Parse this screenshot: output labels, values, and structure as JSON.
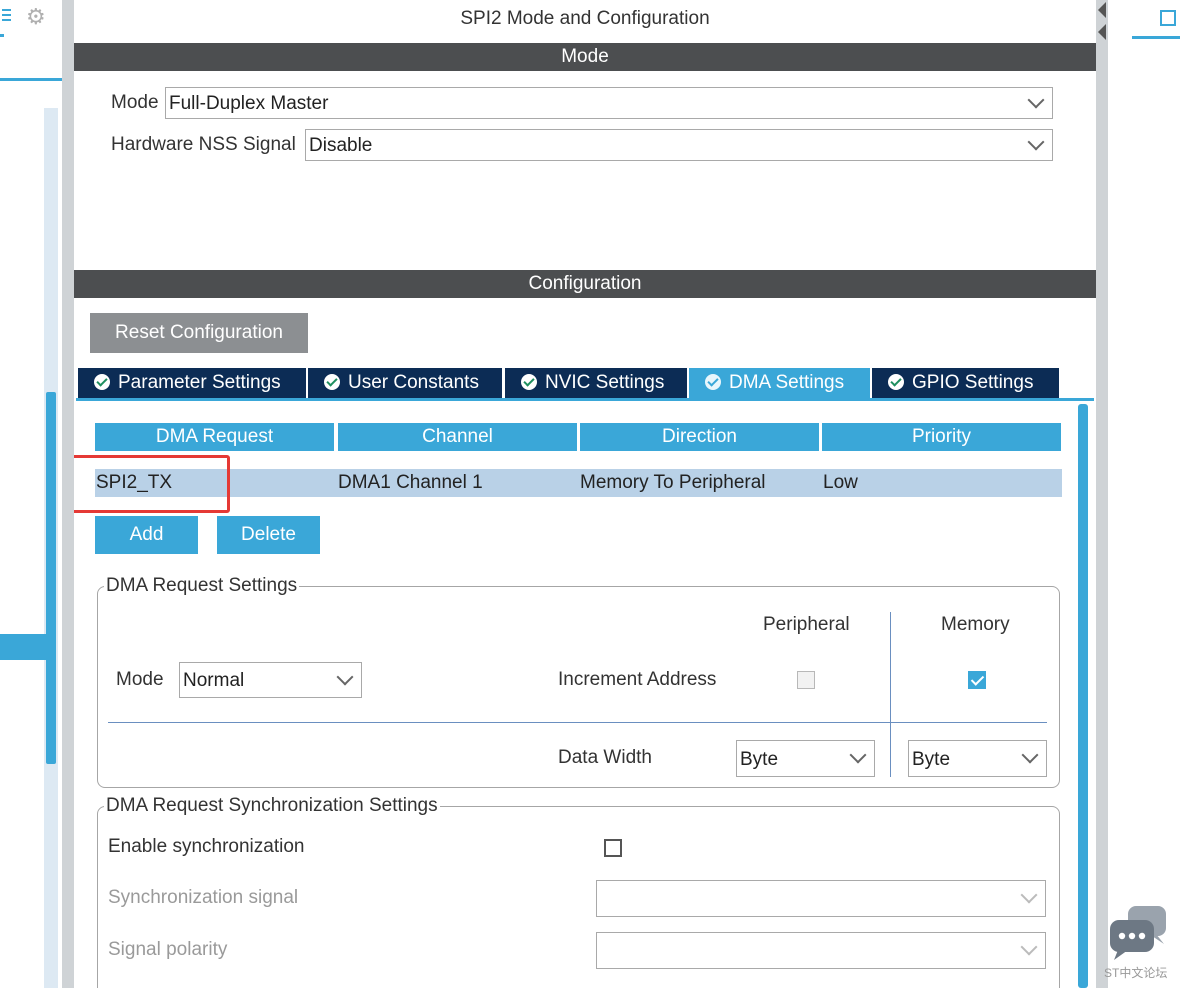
{
  "window_title": "SPI2 Mode and Configuration",
  "mode_section": {
    "header": "Mode",
    "mode_label": "Mode",
    "mode_value": "Full-Duplex Master",
    "nss_label": "Hardware NSS Signal",
    "nss_value": "Disable"
  },
  "config_section": {
    "header": "Configuration",
    "reset_label": "Reset Configuration"
  },
  "tabs": [
    {
      "label": "Parameter Settings",
      "active": false
    },
    {
      "label": "User Constants",
      "active": false
    },
    {
      "label": "NVIC Settings",
      "active": false
    },
    {
      "label": "DMA Settings",
      "active": true
    },
    {
      "label": "GPIO Settings",
      "active": false
    }
  ],
  "dma_table": {
    "columns": [
      "DMA Request",
      "Channel",
      "Direction",
      "Priority"
    ],
    "rows": [
      [
        "SPI2_TX",
        "DMA1 Channel 1",
        "Memory To Peripheral",
        "Low"
      ]
    ]
  },
  "buttons": {
    "add": "Add",
    "delete": "Delete"
  },
  "dma_request_settings": {
    "title": "DMA Request Settings",
    "peripheral_header": "Peripheral",
    "memory_header": "Memory",
    "mode_label": "Mode",
    "mode_value": "Normal",
    "increment_label": "Increment Address",
    "peripheral_increment": false,
    "memory_increment": true,
    "data_width_label": "Data Width",
    "peripheral_width": "Byte",
    "memory_width": "Byte"
  },
  "sync_settings": {
    "title": "DMA Request Synchronization Settings",
    "enable_label": "Enable synchronization",
    "enable_checked": false,
    "signal_label": "Synchronization signal",
    "signal_value": "",
    "polarity_label": "Signal polarity",
    "polarity_value": ""
  },
  "watermark": "ST中文论坛",
  "colors": {
    "accent": "#3aa7d8",
    "tab_dark": "#0c2c55",
    "header_dark": "#4c4e50",
    "row_selected": "#b9d1e7",
    "highlight": "#e53935"
  },
  "icons": [
    "gear-icon",
    "check-circle-icon",
    "chevron-down-icon",
    "chip-icon",
    "chat-icon",
    "collapse-arrow-icon"
  ]
}
